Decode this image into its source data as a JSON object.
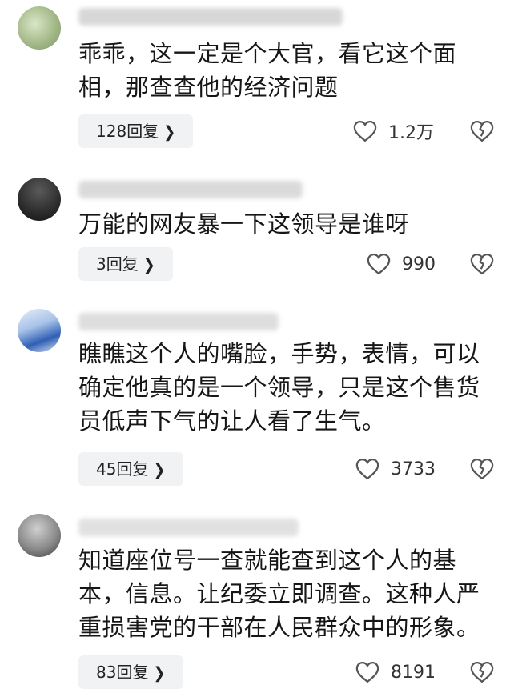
{
  "comments": [
    {
      "text_lines": [
        "乖乖，这一定是个大官，看它这个面",
        "相，那查查他的经济问题"
      ],
      "reply_count": "128",
      "reply_label": "回复",
      "likes": "1.2万"
    },
    {
      "text_lines": [
        "万能的网友暴一下这领导是谁呀"
      ],
      "reply_count": "3",
      "reply_label": "回复",
      "likes": "990"
    },
    {
      "text_lines": [
        "瞧瞧这个人的嘴脸，手势，表情，可以",
        "确定他真的是一个领导，只是这个售货",
        "员低声下气的让人看了生气。"
      ],
      "reply_count": "45",
      "reply_label": "回复",
      "likes": "3733"
    },
    {
      "text_lines": [
        "知道座位号一查就能查到这个人的基",
        "本，信息。让纪委立即调查。这种人严",
        "重损害党的干部在人民群众中的形象。"
      ],
      "reply_count": "83",
      "reply_label": "回复",
      "likes": "8191"
    }
  ],
  "icons": {
    "like": "heart-outline-icon",
    "dislike": "broken-heart-icon",
    "reply_chevron": "chevron-right-icon"
  },
  "colors": {
    "reply_bg": "#f1f2f4",
    "text": "#161616",
    "icon": "#555555"
  }
}
